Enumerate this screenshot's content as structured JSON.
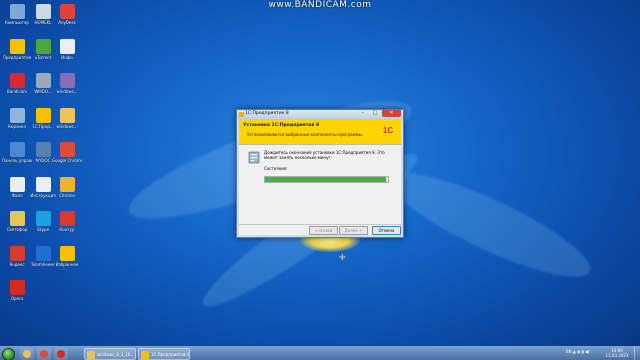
{
  "watermark": "www.BANDICAM.com",
  "desktop_icons": [
    {
      "label": "Компьютер",
      "icon": "computer-icon",
      "color": "#7fa7d6"
    },
    {
      "label": "HOMEKL",
      "icon": "document-icon",
      "color": "#cfd8e3"
    },
    {
      "label": "AnyDesk",
      "icon": "anydesk-icon",
      "color": "#e2403a"
    },
    {
      "label": "Предприятие",
      "icon": "1c-icon",
      "color": "#f2c200"
    },
    {
      "label": "uTorrent",
      "icon": "utorrent-icon",
      "color": "#4ea53c"
    },
    {
      "label": "Инфо",
      "icon": "document-icon",
      "color": "#e9eef5"
    },
    {
      "label": "Bandicam",
      "icon": "bandicam-icon",
      "color": "#d42d2d"
    },
    {
      "label": "WMDO...",
      "icon": "app-icon",
      "color": "#9aa9bd"
    },
    {
      "label": "windows...",
      "icon": "archive-icon",
      "color": "#8b6bb5"
    },
    {
      "label": "Корзина",
      "icon": "recycle-bin-icon",
      "color": "#8fb6d9"
    },
    {
      "label": "1С:Пред...",
      "icon": "1c-icon",
      "color": "#f2c200"
    },
    {
      "label": "windows...",
      "icon": "folder-icon",
      "color": "#e8c55a"
    },
    {
      "label": "Панель управления",
      "icon": "control-panel-icon",
      "color": "#4a8bd0"
    },
    {
      "label": "MYDOC",
      "icon": "app-icon",
      "color": "#5b7fb0"
    },
    {
      "label": "Google Chrome",
      "icon": "chrome-icon",
      "color": "#dd4b39"
    },
    {
      "label": "Файл",
      "icon": "document-icon",
      "color": "#e9eef5"
    },
    {
      "label": "Инструкция",
      "icon": "document-icon",
      "color": "#e9eef5"
    },
    {
      "label": "Chrome",
      "icon": "chrome-icon",
      "color": "#e9b530"
    },
    {
      "label": "Светофор",
      "icon": "folder-icon",
      "color": "#e8c55a"
    },
    {
      "label": "Skype",
      "icon": "skype-icon",
      "color": "#1ba1e2"
    },
    {
      "label": "Контур",
      "icon": "app-icon",
      "color": "#d63b2f"
    },
    {
      "label": "Яндекс",
      "icon": "yandex-icon",
      "color": "#d63b2f"
    },
    {
      "label": "TeamViewer",
      "icon": "teamviewer-icon",
      "color": "#1f6fd0"
    },
    {
      "label": "Избранное",
      "icon": "star-icon",
      "color": "#f2c200"
    },
    {
      "label": "Opera",
      "icon": "opera-icon",
      "color": "#d62a1e"
    }
  ],
  "window": {
    "title": "1С:Предприятие 8",
    "minimize": "–",
    "maximize": "□",
    "close": "✕",
    "banner_title": "Установка 1С:Предприятия 8",
    "banner_subtitle": "Устанавливаются выбранные компоненты программы.",
    "logo_text": "1С",
    "message": "Дождитесь окончания установки 1С:Предприятия 8. Это может занять несколько минут.",
    "status_label": "Состояние:",
    "progress": 0.98,
    "back_button": "< Назад",
    "next_button": "Далее >",
    "cancel_button": "Отмена"
  },
  "taskbar": {
    "pinned": [
      {
        "name": "explorer",
        "icon": "folder-icon",
        "color": "#e8c55a"
      },
      {
        "name": "chrome",
        "icon": "chrome-icon",
        "color": "#dd4b39"
      },
      {
        "name": "opera",
        "icon": "opera-icon",
        "color": "#d62a1e"
      }
    ],
    "tasks": [
      {
        "label": "windows_8_3_16...",
        "icon": "folder-icon",
        "color": "#e8c55a"
      },
      {
        "label": "1С:Предприятие 8",
        "icon": "1c-icon",
        "color": "#f2c200"
      }
    ],
    "tray": "EN ▲ ◆ ▮ ◀)",
    "time": "14:00",
    "date": "11.03.2023"
  },
  "colors": {
    "desktop": "#1566c8",
    "banner": "#ffd400",
    "progress": "#3cb44a"
  }
}
